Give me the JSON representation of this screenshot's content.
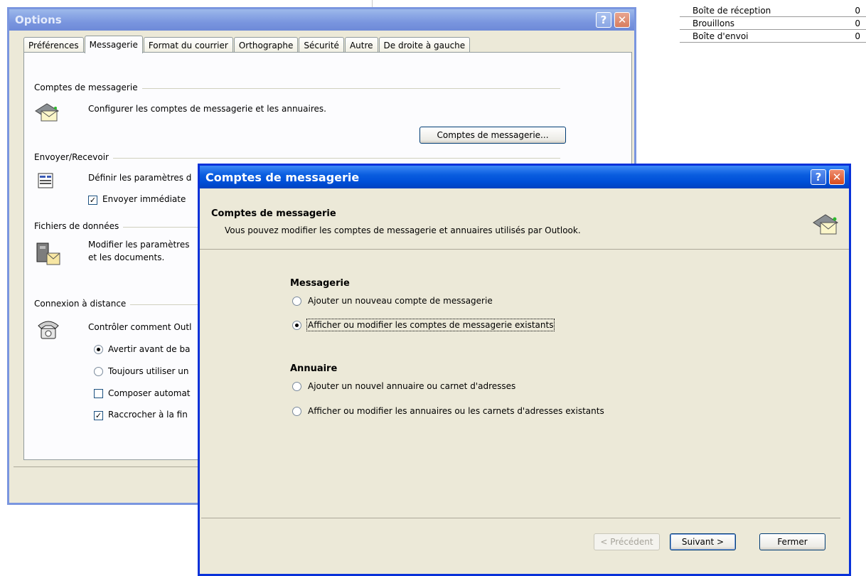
{
  "folders": [
    {
      "name": "Boîte de réception",
      "count": "0"
    },
    {
      "name": "Brouillons",
      "count": "0"
    },
    {
      "name": "Boîte d'envoi",
      "count": "0"
    }
  ],
  "options": {
    "title": "Options",
    "help": "?",
    "close": "✕",
    "tabs": [
      "Préférences",
      "Messagerie",
      "Format du courrier",
      "Orthographe",
      "Sécurité",
      "Autre",
      "De droite à gauche"
    ],
    "sections": {
      "comptes": {
        "label": "Comptes de messagerie",
        "text": "Configurer les comptes de messagerie et les annuaires.",
        "button": "Comptes de messagerie..."
      },
      "envoyer": {
        "label": "Envoyer/Recevoir",
        "text": "Définir les paramètres d",
        "check": "Envoyer immédiate"
      },
      "fichiers": {
        "label": "Fichiers de données",
        "text1": "Modifier les paramètres",
        "text2": "et les documents."
      },
      "connexion": {
        "label": "Connexion à distance",
        "text": "Contrôler comment Outl",
        "radio1": "Avertir avant de ba",
        "radio2": "Toujours utiliser un",
        "check1": "Composer automat",
        "check2": "Raccrocher à la fin"
      }
    }
  },
  "dialog": {
    "title": "Comptes de messagerie",
    "help": "?",
    "close": "✕",
    "header_title": "Comptes de messagerie",
    "header_sub": "Vous pouvez modifier les comptes de messagerie et annuaires utilisés par Outlook.",
    "messagerie_label": "Messagerie",
    "msg_opt1": "Ajouter un nouveau compte de messagerie",
    "msg_opt2": "Afficher ou modifier les comptes de messagerie existants",
    "annuaire_label": "Annuaire",
    "ann_opt1": "Ajouter un nouvel annuaire ou carnet d'adresses",
    "ann_opt2": "Afficher ou modifier les annuaires ou les carnets d'adresses existants",
    "btn_prev": "< Précédent",
    "btn_next": "Suivant >",
    "btn_close": "Fermer",
    "selected_option": "msg_opt2"
  }
}
